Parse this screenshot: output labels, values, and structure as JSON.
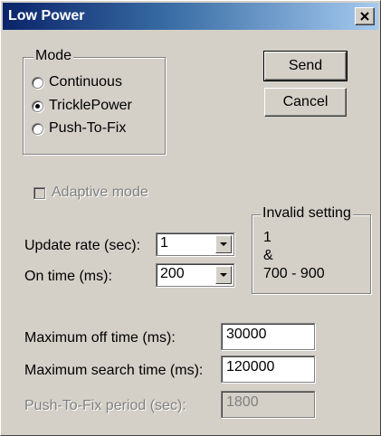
{
  "window": {
    "title": "Low Power",
    "close_icon": "close-x-icon"
  },
  "mode_group": {
    "legend": "Mode",
    "options": [
      {
        "label": "Continuous",
        "checked": false
      },
      {
        "label": "TricklePower",
        "checked": true
      },
      {
        "label": "Push-To-Fix",
        "checked": false
      }
    ]
  },
  "buttons": {
    "send": "Send",
    "cancel": "Cancel"
  },
  "adaptive_mode": {
    "label": "Adaptive mode",
    "checked": false,
    "enabled": false
  },
  "update_rate": {
    "label": "Update rate (sec):",
    "value": "1"
  },
  "on_time": {
    "label": "On time (ms):",
    "value": "200"
  },
  "invalid_group": {
    "legend": "Invalid setting",
    "lines": [
      "1",
      "&",
      "700 - 900"
    ]
  },
  "max_off_time": {
    "label": "Maximum off time (ms):",
    "value": "30000"
  },
  "max_search_time": {
    "label": "Maximum search time (ms):",
    "value": "120000"
  },
  "ptf_period": {
    "label": "Push-To-Fix period (sec):",
    "value": "1800",
    "enabled": false
  }
}
